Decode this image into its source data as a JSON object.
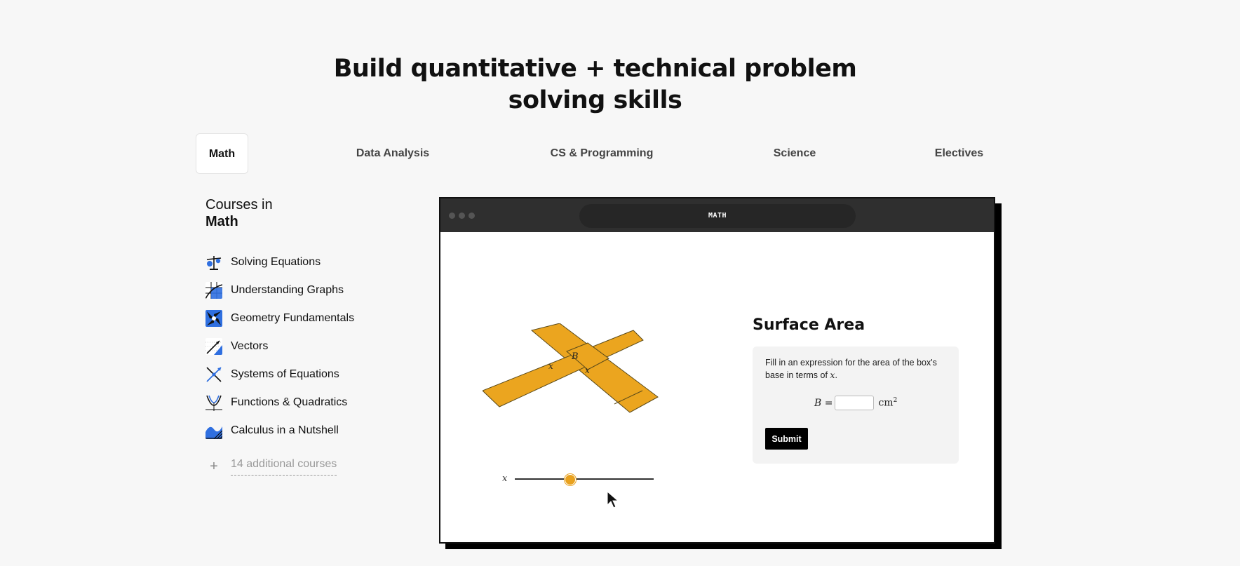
{
  "headline": {
    "line1": "Build quantitative + technical problem",
    "line2": "solving skills"
  },
  "tabs": [
    {
      "label": "Math",
      "active": true
    },
    {
      "label": "Data Analysis",
      "active": false
    },
    {
      "label": "CS & Programming",
      "active": false
    },
    {
      "label": "Science",
      "active": false
    },
    {
      "label": "Electives",
      "active": false
    }
  ],
  "sidebar": {
    "intro": "Courses in",
    "subject": "Math",
    "courses": [
      {
        "label": "Solving Equations",
        "icon": "balance-scale-icon"
      },
      {
        "label": "Understanding Graphs",
        "icon": "graph-icon"
      },
      {
        "label": "Geometry Fundamentals",
        "icon": "geometry-icon"
      },
      {
        "label": "Vectors",
        "icon": "vector-icon"
      },
      {
        "label": "Systems of Equations",
        "icon": "intersecting-lines-icon"
      },
      {
        "label": "Functions & Quadratics",
        "icon": "parabola-icon"
      },
      {
        "label": "Calculus in a Nutshell",
        "icon": "area-under-curve-icon"
      }
    ],
    "more_label": "14 additional courses",
    "more_icon": "plus-icon"
  },
  "window": {
    "url_label": "MATH",
    "net": {
      "left_label": "x",
      "center_label": "B",
      "right_label": "x",
      "fill": "#eba51f"
    },
    "slider": {
      "label": "x",
      "value": 0.4
    },
    "panel": {
      "title": "Surface Area",
      "prompt": "Fill in an expression for the area of the box's base in terms of",
      "prompt_var": "x",
      "eq_lhs": "B =",
      "input_value": "",
      "unit": "cm",
      "unit_exp": "2",
      "submit_label": "Submit"
    }
  },
  "colors": {
    "accent": "#eba51f",
    "blue": "#2f6fe0",
    "dark": "#111111"
  }
}
